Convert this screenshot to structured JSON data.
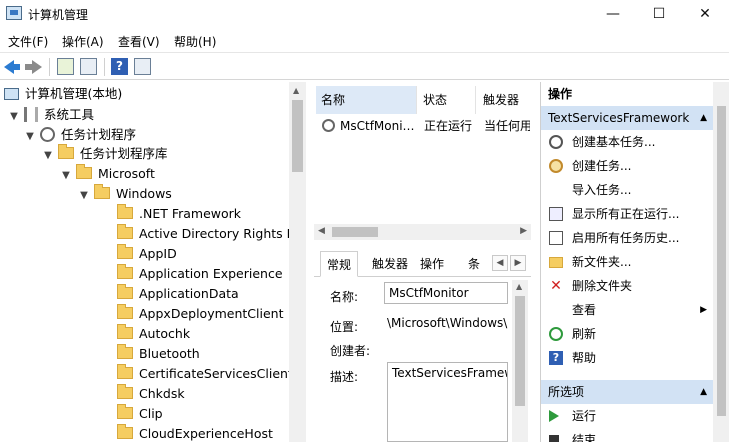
{
  "window": {
    "title": "计算机管理",
    "minimize": "—",
    "maximize": "☐",
    "close": "✕"
  },
  "menu": [
    "文件(F)",
    "操作(A)",
    "查看(V)",
    "帮助(H)"
  ],
  "toolbar": {
    "icons": [
      "back-arrow-icon",
      "forward-arrow-icon",
      "up-folder-icon",
      "show-pane-icon",
      "help-icon",
      "properties-icon"
    ],
    "help_glyph": "?"
  },
  "tree": {
    "root": "计算机管理(本地)",
    "system_tools": "系统工具",
    "task_scheduler": "任务计划程序",
    "task_library": "任务计划程序库",
    "microsoft": "Microsoft",
    "windows": "Windows",
    "folders": [
      ".NET Framework",
      "Active Directory Rights Ma",
      "AppID",
      "Application Experience",
      "ApplicationData",
      "AppxDeploymentClient",
      "Autochk",
      "Bluetooth",
      "CertificateServicesClient",
      "Chkdsk",
      "Clip",
      "CloudExperienceHost"
    ]
  },
  "tasks": {
    "columns": [
      "名称",
      "状态",
      "触发器"
    ],
    "rows": [
      {
        "name": "MsCtfMoni…",
        "status": "正在运行",
        "trigger": "当任何用"
      }
    ]
  },
  "details": {
    "tabs": [
      "常规",
      "触发器",
      "操作",
      "条件"
    ],
    "name_label": "名称:",
    "name_value": "MsCtfMonitor",
    "location_label": "位置:",
    "location_value": "\\Microsoft\\Windows\\",
    "author_label": "创建者:",
    "desc_label": "描述:",
    "desc_value": "TextServicesFramew"
  },
  "actions": {
    "header": "操作",
    "section1": "TextServicesFramework",
    "items1": [
      "创建基本任务...",
      "创建任务...",
      "导入任务...",
      "显示所有正在运行...",
      "启用所有任务历史...",
      "新文件夹...",
      "删除文件夹",
      "查看",
      "刷新",
      "帮助"
    ],
    "section2": "所选项",
    "items2": [
      "运行",
      "结束"
    ]
  },
  "colors": {
    "selected_header": "#d2e2f4",
    "accent": "#2b7bd1"
  }
}
